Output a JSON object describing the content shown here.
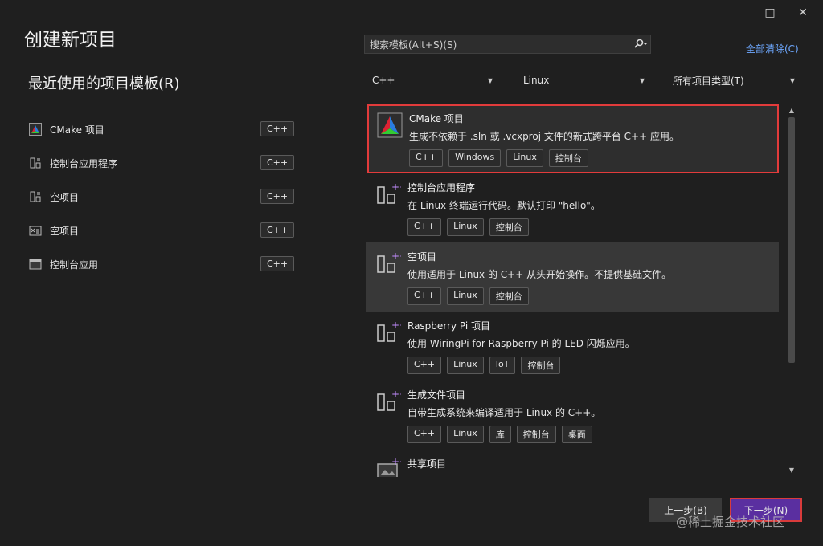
{
  "window": {
    "maximize_icon": "□",
    "close_icon": "✕"
  },
  "title": "创建新项目",
  "recent": {
    "heading": "最近使用的项目模板(R)",
    "items": [
      {
        "label": "CMake 项目",
        "tag": "C++",
        "icon": "cmake-icon"
      },
      {
        "label": "控制台应用程序",
        "tag": "C++",
        "icon": "console-app-icon"
      },
      {
        "label": "空项目",
        "tag": "C++",
        "icon": "empty-project-icon"
      },
      {
        "label": "空项目",
        "tag": "C++",
        "icon": "empty-project-2-icon"
      },
      {
        "label": "控制台应用",
        "tag": "C++",
        "icon": "console-icon"
      }
    ]
  },
  "search": {
    "placeholder": "搜索模板(Alt+S)(S)"
  },
  "clear_all": "全部清除(C)",
  "filters": {
    "language": "C++",
    "platform": "Linux",
    "project_type": "所有项目类型(T)"
  },
  "templates": [
    {
      "name": "CMake 项目",
      "desc": "生成不依赖于 .sln 或 .vcxproj 文件的新式跨平台 C++ 应用。",
      "tags": [
        "C++",
        "Windows",
        "Linux",
        "控制台"
      ]
    },
    {
      "name": "控制台应用程序",
      "desc": "在 Linux 终端运行代码。默认打印 \"hello\"。",
      "tags": [
        "C++",
        "Linux",
        "控制台"
      ]
    },
    {
      "name": "空项目",
      "desc": "使用适用于 Linux 的 C++ 从头开始操作。不提供基础文件。",
      "tags": [
        "C++",
        "Linux",
        "控制台"
      ]
    },
    {
      "name": "Raspberry Pi 项目",
      "desc": "使用 WiringPi for Raspberry Pi 的 LED 闪烁应用。",
      "tags": [
        "C++",
        "Linux",
        "IoT",
        "控制台"
      ]
    },
    {
      "name": "生成文件项目",
      "desc": "自带生成系统来编译适用于 Linux 的 C++。",
      "tags": [
        "C++",
        "Linux",
        "库",
        "控制台",
        "桌面"
      ]
    },
    {
      "name": "共享项目",
      "desc": "",
      "tags": []
    }
  ],
  "buttons": {
    "back": "上一步(B)",
    "next": "下一步(N)"
  },
  "watermark": "@稀土掘金技术社区"
}
